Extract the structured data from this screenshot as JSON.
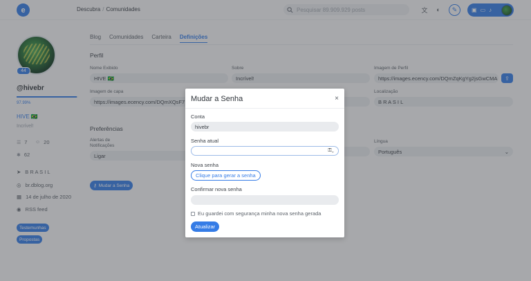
{
  "topbar": {
    "logo": "e",
    "breadcrumb": [
      "Descubra",
      "Comunidades"
    ],
    "breadcrumb_sep": "/",
    "search_placeholder": "Pesquisar 89.909.929 posts",
    "icons": [
      "translate-icon",
      "theme-icon",
      "edit-icon",
      "wallet-icon",
      "card-icon",
      "bell-icon",
      "avatar"
    ]
  },
  "profile": {
    "reputation": "44",
    "username": "@hivebr",
    "voting_power_text": "97.99%",
    "voting_power": 0.9799,
    "name": "HIVE 🇧🇷",
    "about": "Incrível!",
    "followers": "7",
    "following": "20",
    "posts": "62",
    "location": "B R A S I L",
    "website": "br.dblog.org",
    "joined": "14 de julho de 2020",
    "rss": "RSS feed",
    "tags": [
      "Testemunhas",
      "Propostas"
    ]
  },
  "tabs": [
    "Blog",
    "Comunidades",
    "Carteira",
    "Definições"
  ],
  "settings": {
    "section_profile": "Perfil",
    "display_name_label": "Nome Exibido",
    "display_name": "HIVE 🇧🇷",
    "about_label": "Sobre",
    "about": "Incrível!",
    "profile_image_label": "Imagem de Perfil",
    "profile_image": "https://images.ecency.com/DQmZqKgYg2jsGwCMA",
    "cover_image_label": "Imagem de capa",
    "cover_image": "https://images.ecency.com/DQmXQsF7",
    "location_label": "Localização",
    "location": "B R A S I L",
    "section_prefs": "Preferências",
    "notif_label": "Alertas de Notificações",
    "notif_value": "Ligar",
    "language_label": "Língua",
    "language_value": "Português",
    "change_password_button": "Mudar a Senha"
  },
  "modal": {
    "title": "Mudar a Senha",
    "close": "×",
    "account_label": "Conta",
    "account_value": "hivebr",
    "current_password_label": "Senha atual",
    "new_password_label": "Nova senha",
    "generate_button": "Clique para gerar a senha",
    "confirm_label": "Confirmar nova senha",
    "checkbox_label": "Eu guardei com segurança minha nova senha gerada",
    "submit_button": "Atualizar"
  },
  "colors": {
    "accent": "#357ce6",
    "overlay": "rgba(60,62,66,0.42)"
  }
}
